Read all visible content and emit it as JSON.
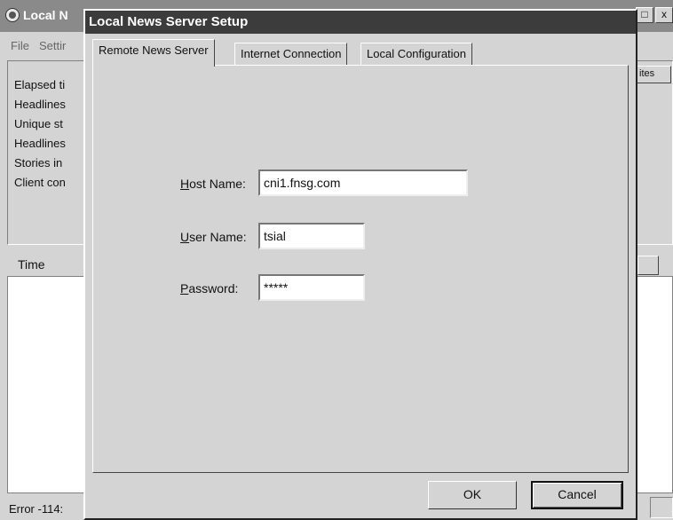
{
  "background_window": {
    "title": "Local N",
    "close_glyph": "x",
    "menu": [
      "File",
      "Settir"
    ],
    "stats": [
      "Elapsed ti",
      "Headlines",
      "Unique st",
      "Headlines",
      "Stories in",
      "Client con"
    ],
    "column_header_right": "ites",
    "list_header_time": "Time",
    "status_text": "Error -114:"
  },
  "dialog": {
    "title": "Local News Server Setup",
    "tabs": [
      {
        "label": "Remote News Server",
        "active": true
      },
      {
        "label": "Internet Connection",
        "active": false
      },
      {
        "label": "Local Configuration",
        "active": false
      }
    ],
    "fields": {
      "host": {
        "label_accel": "H",
        "label_rest": "ost Name:",
        "value": "cni1.fnsg.com"
      },
      "user": {
        "label_accel": "U",
        "label_rest": "ser Name:",
        "value": "tsial"
      },
      "password": {
        "label_accel": "P",
        "label_rest": "assword:",
        "value": "*****"
      }
    },
    "buttons": {
      "ok": "OK",
      "cancel": "Cancel"
    }
  }
}
